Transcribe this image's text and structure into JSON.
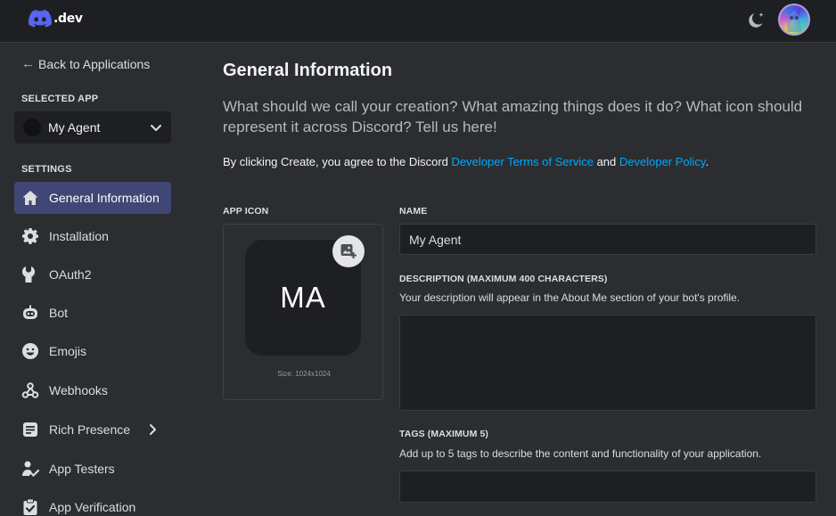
{
  "header": {
    "logo_text": ".dev",
    "icons": {
      "logo": "discord-logo-icon",
      "theme": "moon-sparkle-icon",
      "avatar": "user-avatar"
    }
  },
  "sidebar": {
    "back_label": "Back to Applications",
    "selected_app_heading": "SELECTED APP",
    "selected_app_name": "My Agent",
    "settings_heading": "SETTINGS",
    "items": [
      {
        "label": "General Information",
        "icon": "home-icon",
        "active": true
      },
      {
        "label": "Installation",
        "icon": "gear-icon"
      },
      {
        "label": "OAuth2",
        "icon": "wrench-icon"
      },
      {
        "label": "Bot",
        "icon": "robot-icon"
      },
      {
        "label": "Emojis",
        "icon": "smiley-icon"
      },
      {
        "label": "Webhooks",
        "icon": "webhook-icon"
      },
      {
        "label": "Rich Presence",
        "icon": "document-icon",
        "has_submenu": true
      },
      {
        "label": "App Testers",
        "icon": "user-check-icon"
      },
      {
        "label": "App Verification",
        "icon": "clipboard-check-icon"
      }
    ]
  },
  "main": {
    "title": "General Information",
    "description": "What should we call your creation? What amazing things does it do? What icon should represent it across Discord? Tell us here!",
    "terms_prefix": "By clicking Create, you agree to the Discord ",
    "terms_link1": "Developer Terms of Service",
    "terms_and": " and ",
    "terms_link2": "Developer Policy",
    "terms_suffix": ".",
    "app_icon": {
      "label": "APP ICON",
      "initials": "MA",
      "size_note": "Size: 1024x1024"
    },
    "name_field": {
      "label": "NAME",
      "value": "My Agent"
    },
    "description_field": {
      "label": "DESCRIPTION (MAXIMUM 400 CHARACTERS)",
      "help": "Your description will appear in the About Me section of your bot's profile.",
      "value": ""
    },
    "tags_field": {
      "label": "TAGS (MAXIMUM 5)",
      "help": "Add up to 5 tags to describe the content and functionality of your application.",
      "value": ""
    }
  },
  "colors": {
    "background": "#2b2d31",
    "topbar": "#1e1f22",
    "active_nav": "#404675",
    "link": "#00a8fc",
    "input_bg": "#1e1f22"
  }
}
